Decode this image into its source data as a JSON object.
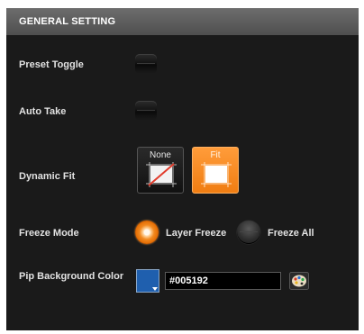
{
  "header": {
    "title": "GENERAL SETTING"
  },
  "preset_toggle": {
    "label": "Preset Toggle",
    "on": false
  },
  "auto_take": {
    "label": "Auto Take",
    "on": false
  },
  "dynamic_fit": {
    "label": "Dynamic Fit",
    "options": [
      "None",
      "Fit"
    ],
    "selected": "Fit"
  },
  "freeze_mode": {
    "label": "Freeze Mode",
    "options": [
      "Layer Freeze",
      "Freeze All"
    ],
    "selected": "Layer Freeze"
  },
  "pip_background": {
    "label": "Pip Background Color",
    "value": "#005192",
    "swatch_color": "#1f5fae"
  },
  "colors": {
    "panel_bg": "#1a1a1a",
    "accent_orange": "#f28a20"
  }
}
